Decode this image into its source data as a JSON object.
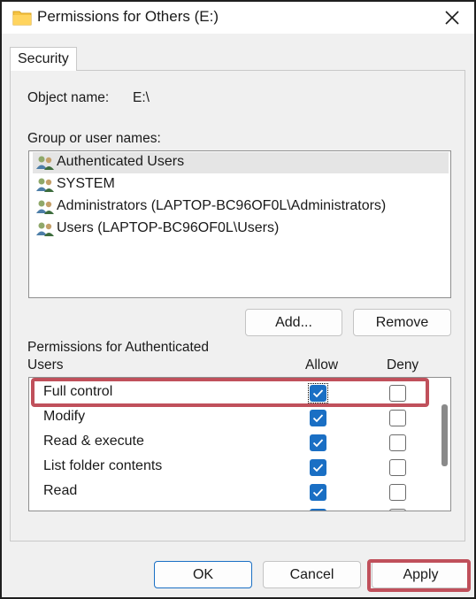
{
  "window": {
    "title": "Permissions for Others (E:)"
  },
  "tabs": [
    {
      "label": "Security"
    }
  ],
  "object": {
    "label": "Object name:",
    "value": "E:\\"
  },
  "groups": {
    "label": "Group or user names:",
    "items": [
      {
        "name": "Authenticated Users",
        "selected": true
      },
      {
        "name": "SYSTEM",
        "selected": false
      },
      {
        "name": "Administrators (LAPTOP-BC96OF0L\\Administrators)",
        "selected": false
      },
      {
        "name": "Users (LAPTOP-BC96OF0L\\Users)",
        "selected": false
      }
    ],
    "add_label": "Add...",
    "remove_label": "Remove"
  },
  "permissions": {
    "label_line1": "Permissions for Authenticated",
    "label_line2": "Users",
    "allow_header": "Allow",
    "deny_header": "Deny",
    "rows": [
      {
        "name": "Full control",
        "allow": true,
        "deny": false
      },
      {
        "name": "Modify",
        "allow": true,
        "deny": false
      },
      {
        "name": "Read & execute",
        "allow": true,
        "deny": false
      },
      {
        "name": "List folder contents",
        "allow": true,
        "deny": false
      },
      {
        "name": "Read",
        "allow": true,
        "deny": false
      }
    ]
  },
  "footer": {
    "ok_label": "OK",
    "cancel_label": "Cancel",
    "apply_label": "Apply"
  },
  "colors": {
    "checkbox_checked": "#1a6fc4",
    "highlight": "#c0505b",
    "folder": "#f5c342"
  }
}
